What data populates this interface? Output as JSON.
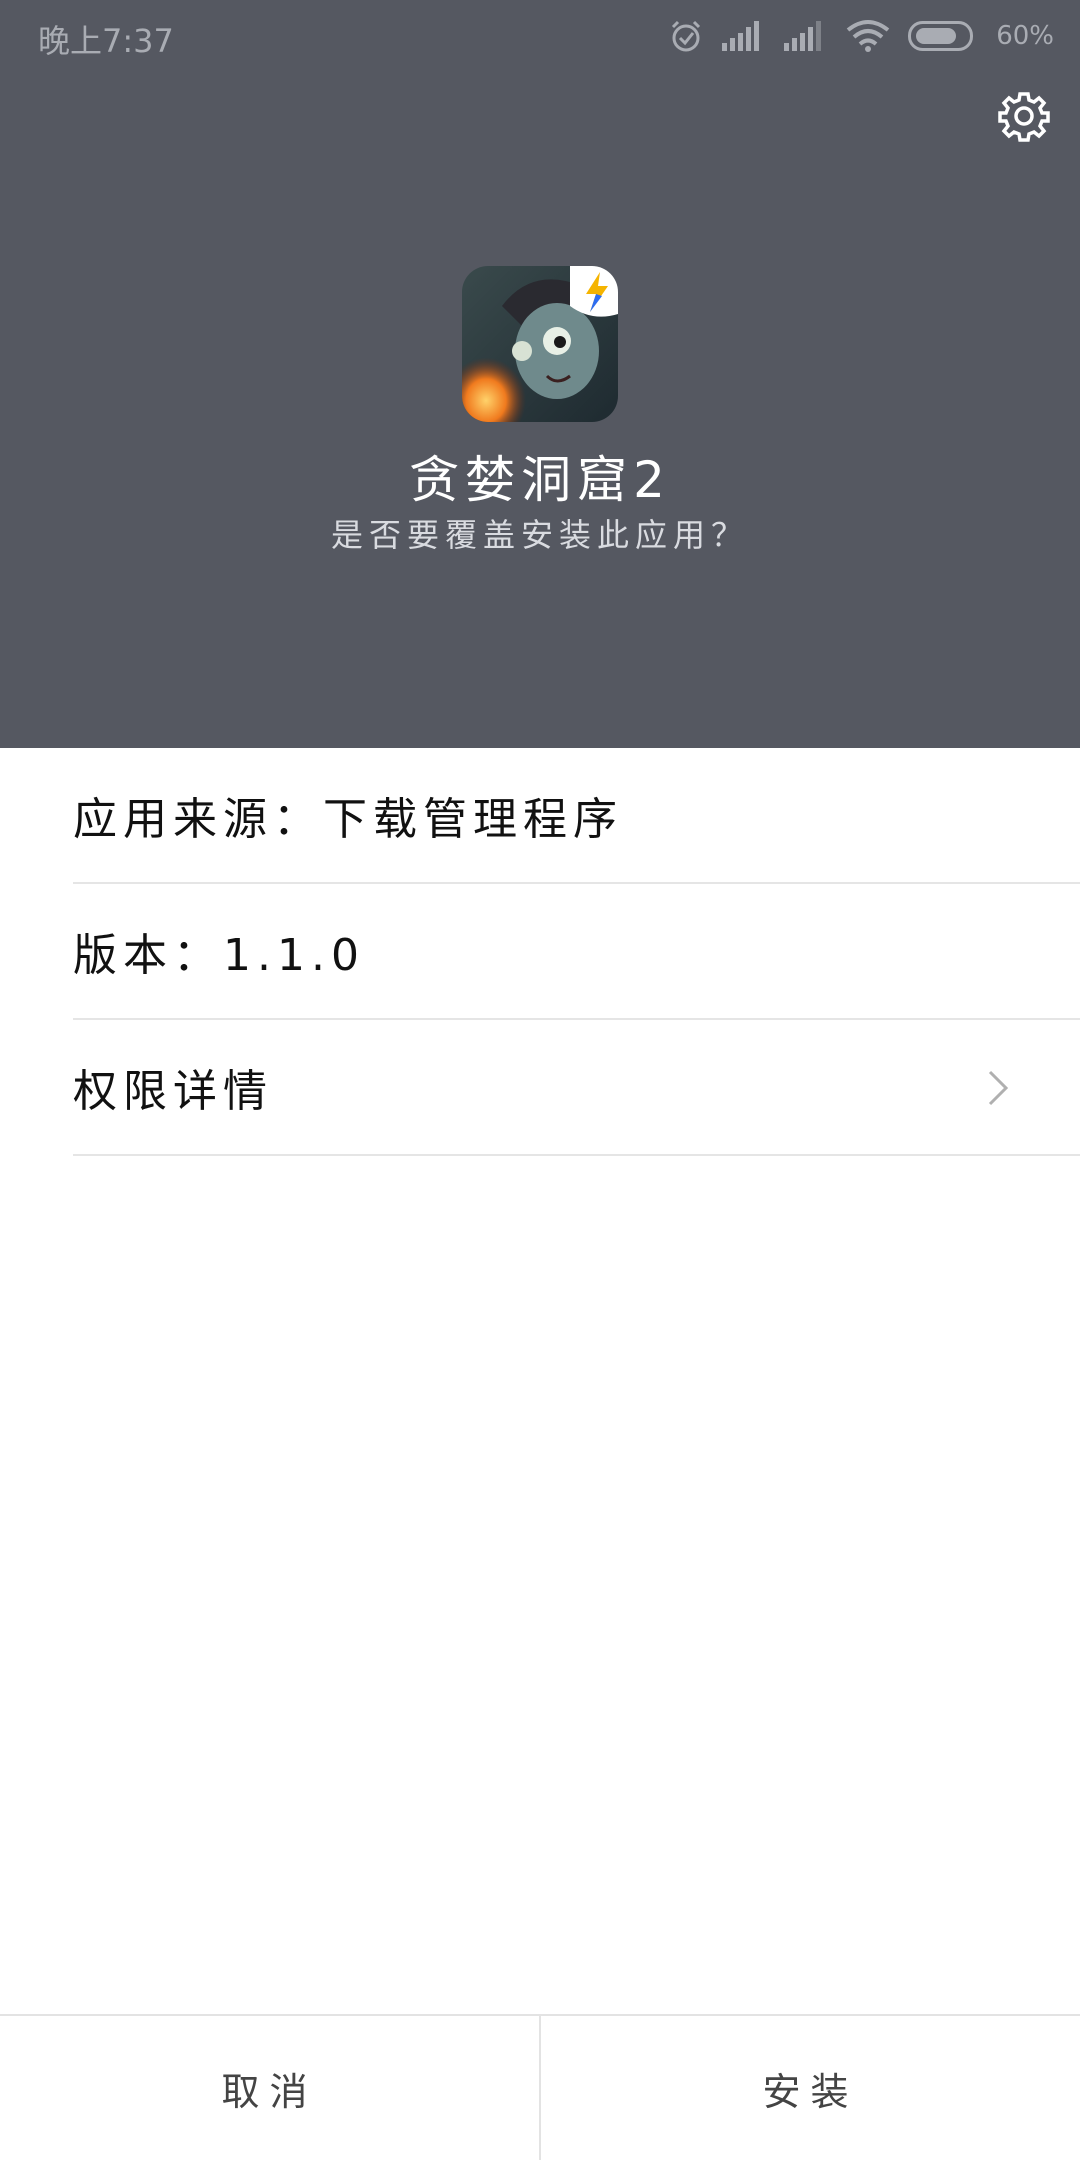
{
  "status_bar": {
    "time": "晚上7:37",
    "battery": "60%",
    "icons": [
      "alarm-icon",
      "signal-icon",
      "signal-icon",
      "wifi-icon",
      "battery-icon"
    ]
  },
  "header": {
    "app_name": "贪婪洞窟2",
    "prompt": "是否要覆盖安装此应用？",
    "settings_icon": "gear-icon"
  },
  "details": {
    "source": "应用来源：下载管理程序",
    "version": "版本：1.1.0",
    "permissions": "权限详情"
  },
  "footer": {
    "cancel": "取消",
    "install": "安装"
  },
  "colors": {
    "header_bg": "#555861",
    "divider": "#e5e5e5"
  }
}
